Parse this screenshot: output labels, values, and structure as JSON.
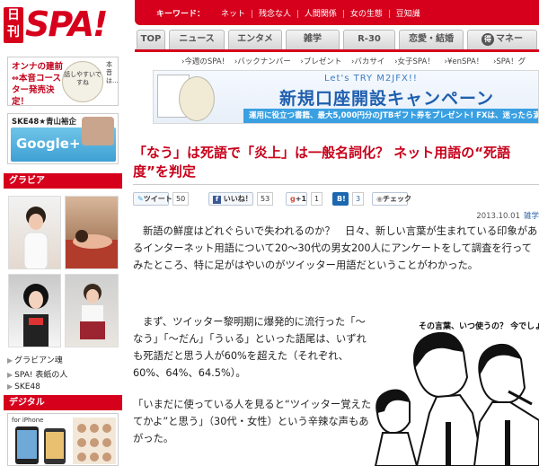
{
  "header": {
    "logo_kanji": "日刊",
    "logo_text": "SPA!",
    "keyword_label": "キーワード：",
    "keywords": [
      "ネット",
      "残念な人",
      "人間関係",
      "女の生態",
      "豆知識"
    ]
  },
  "nav": {
    "tabs": [
      {
        "label": "TOP"
      },
      {
        "label": "ニュース"
      },
      {
        "label": "エンタメ"
      },
      {
        "label": "雑学"
      },
      {
        "label": "R-30"
      },
      {
        "label": "恋愛・結婚"
      },
      {
        "label": "マネー"
      }
    ],
    "money_icon": "得"
  },
  "sidebar": {
    "ad_coaster": {
      "text": "オンナの建前⇔本音コースター発売決定！",
      "coaster_text": "話しやすいですね",
      "side_text": "本音は…"
    },
    "ad_ske": {
      "title": "SKE48★青山裕企",
      "gplus": "Google+"
    },
    "gravure_head": "グラビア",
    "links": [
      "グラビアン魂",
      "SPA! 表紙の人",
      "SKE48"
    ],
    "digital_head": "デジタル",
    "digital_phone": "for iPhone"
  },
  "main": {
    "breadcrumbs": [
      "›今週のSPA!",
      "›バックナンバー",
      "›プレゼント",
      "›バカサイ",
      "›女子SPA！",
      "›¥enSPA！",
      "›SPA！グ"
    ],
    "banner": {
      "sub": "Let's TRY M2JFX!!",
      "main_copy": "新規口座開設キャンペーン",
      "strip": "運用に役立つ書籍、最大5,000円分のJTBギフト券をプレゼント! FXは、迷ったら満期"
    },
    "title": "「なう」は死語で「炎上」は一般名詞化？ ネット用語の“死語度”を判定",
    "social": {
      "tweet_label": "ツイート",
      "tweet_count": "50",
      "like_label": "いいね！",
      "like_count": "53",
      "gplus_label": "+1",
      "gplus_count": "1",
      "hatena_label": "B!",
      "hatena_count": "3",
      "check_label": "チェック"
    },
    "date": "2013.10.01",
    "category": "雑学",
    "paragraphs": [
      "新語の鮮度はどれぐらいで失われるのか？　日々、新しい言葉が生まれている印象があるインターネット用語について20～30代の男女200人にアンケートをして調査を行ってみたところ、特に足がはやいのがツイッター用語だということがわかった。",
      "まず、ツイッター黎明期に爆発的に流行った「～なう」「～だん」「うぃる」といった語尾は、いずれも死語だと思う人が60%を超えた（それぞれ、60%、64%、64.5%）。",
      "「いまだに使っている人を見ると“ツイッター覚えたてかよ”と思う」（30代・女性）という辛辣な声もあがった。"
    ],
    "illustration_caption": "その言葉、いつ使うの？ 今でしょ!!"
  }
}
